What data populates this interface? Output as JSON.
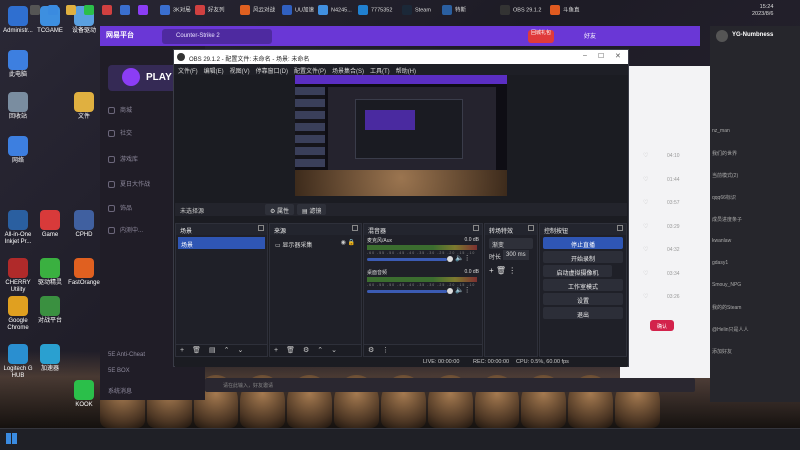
{
  "desktop_icons": [
    {
      "label": "Administr...",
      "color": "#2f6fd0"
    },
    {
      "label": "TCGAME",
      "color": "#3d8fe0"
    },
    {
      "label": "设备驱动",
      "color": "#5aa0e0"
    },
    {
      "label": "此电脑",
      "color": "#3d7fe0"
    },
    {
      "label": "回收站",
      "color": "#7a8da0"
    },
    {
      "label": "文件",
      "color": "#e0b040"
    },
    {
      "label": "网络",
      "color": "#3d7fe0"
    },
    {
      "label": "Game",
      "color": "#d83a3a"
    },
    {
      "label": "CPHD",
      "color": "#4060a0"
    },
    {
      "label": "All-in-One Inkjet Pr...",
      "color": "#2a5fa0"
    },
    {
      "label": "CHERRY Utility",
      "color": "#b02a2a"
    },
    {
      "label": "驱动精灵",
      "color": "#3ab040"
    },
    {
      "label": "Google Chrome",
      "color": "#e0a020"
    },
    {
      "label": "对战平台",
      "color": "#3a9040"
    },
    {
      "label": "FastOrange",
      "color": "#e06020"
    },
    {
      "label": "Logitech G HUB",
      "color": "#2a8fd0"
    },
    {
      "label": "加速器",
      "color": "#2aa0d0"
    },
    {
      "label": "KOOK",
      "color": "#2bbf4a"
    }
  ],
  "game_client": {
    "logo": "网易平台",
    "tab": "Counter-Strike 2",
    "play": "PLAY",
    "badge": "回城礼包",
    "friends_btn": "好友",
    "nav": [
      "商城",
      "社交",
      "游戏库",
      "夏日大作战",
      "饰品",
      "内测中..."
    ],
    "bottom_nav": [
      "5E Anti-Cheat",
      "5E BOX",
      "系统消息"
    ]
  },
  "friends_panel": {
    "user": "YG-Numbness",
    "rows": [
      "nz_man",
      "我们的世界",
      "当前模式(2)",
      "qqq66标识",
      "成员进度条子",
      "kwanlaw",
      "gdasy1",
      "Smouy_NPG",
      "我的的Steam",
      "@Helin只是人人",
      "添加好友"
    ]
  },
  "chat": {
    "times": [
      "04:10",
      "01:44",
      "03:57",
      "03:29",
      "04:32",
      "03:34",
      "03:26"
    ],
    "confirm_btn": "确认",
    "input_placeholder": "请在此输入，好友邀请"
  },
  "obs": {
    "title": "OBS 29.1.2 - 配置文件: 未命名 - 场景: 未命名",
    "menu": [
      "文件(F)",
      "编辑(E)",
      "视图(V)",
      "停靠窗口(D)",
      "配置文件(P)",
      "场景集合(S)",
      "工具(T)",
      "帮助(H)"
    ],
    "source_toolbar": {
      "label": "未选择源",
      "properties": "属性",
      "filters": "滤镜"
    },
    "docks": {
      "scenes": {
        "title": "场景",
        "items": [
          "场景"
        ]
      },
      "sources": {
        "title": "来源",
        "items": [
          "显示器采集"
        ]
      },
      "mixer": {
        "title": "混音器",
        "channels": [
          {
            "name": "麦克风/Aux",
            "db": "0.0 dB"
          },
          {
            "name": "桌面音频",
            "db": "0.0 dB"
          }
        ],
        "scale": "-60 -55 -50 -45 -40 -35 -30 -25 -20 -15 -10 -5 0"
      },
      "transitions": {
        "title": "转场特效",
        "type": "渐变",
        "duration_label": "时长",
        "duration": "300 ms"
      },
      "controls": {
        "title": "控制按钮",
        "buttons": [
          "停止直播",
          "开始录制",
          "启动虚拟摄像机",
          "工作室模式",
          "设置",
          "退出"
        ]
      }
    },
    "status": {
      "live": "LIVE: 00:00:00",
      "rec": "REC: 00:00:00",
      "cpu": "CPU: 0.5%, 60.00 fps"
    }
  },
  "taskbar": {
    "items": [
      "3K对局",
      "好友列",
      "风云对战",
      "UU加速",
      "N4245...",
      "7775352",
      "Steam",
      "特斯",
      "OBS 29.1.2",
      "斗鱼直"
    ],
    "time": "15:24",
    "date": "2023/8/6"
  }
}
